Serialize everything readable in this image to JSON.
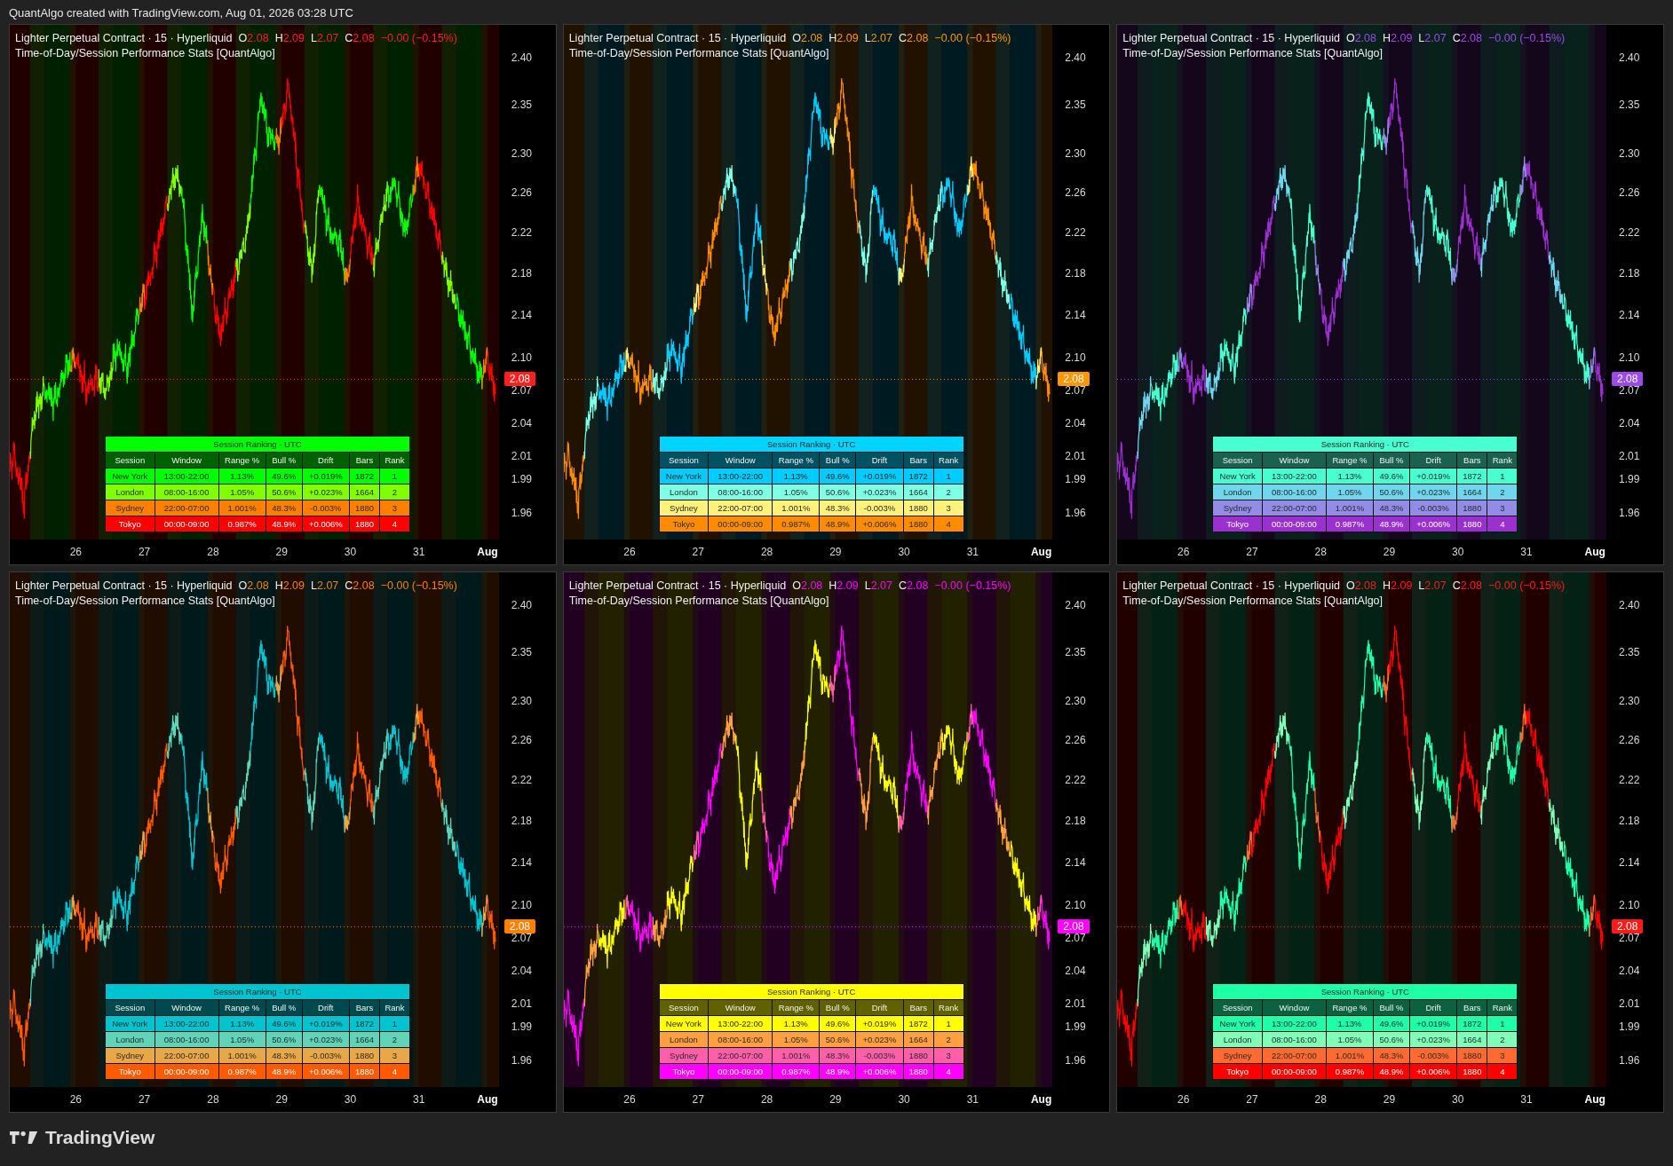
{
  "caption": "QuantAlgo created with TradingView.com, Aug 01, 2026 03:28 UTC",
  "panels": [
    {
      "symbol": "Lighter Perpetual Contract · 15 · Hyperliquid",
      "quote": [
        {
          "label": "O",
          "value": "2.08"
        },
        {
          "label": "H",
          "value": "2.09"
        },
        {
          "label": "L",
          "value": "2.07"
        },
        {
          "label": "C",
          "value": "2.08"
        }
      ],
      "change": "−0.00 (−0.15%)",
      "indicator": "Time-of-Day/Session Performance Stats [QuantAlgo]",
      "color": "#ff1f1f",
      "last_price": "2.08",
      "price_scale": [
        "2.40",
        "2.35",
        "2.30",
        "2.26",
        "2.22",
        "2.18",
        "2.14",
        "2.10",
        "2.07",
        "2.04",
        "2.01",
        "1.99",
        "1.96"
      ],
      "time_scale": [
        {
          "label": "26",
          "kind": "day"
        },
        {
          "label": "27",
          "kind": "day"
        },
        {
          "label": "28",
          "kind": "day"
        },
        {
          "label": "29",
          "kind": "day"
        },
        {
          "label": "30",
          "kind": "day"
        },
        {
          "label": "31",
          "kind": "day"
        },
        {
          "label": "Aug",
          "kind": "month"
        }
      ],
      "table": {
        "title": "Session Ranking · UTC",
        "color": "#00ff00",
        "columns": [
          "Session",
          "Window",
          "Range %",
          "Bull %",
          "Drift",
          "Bars",
          "Rank"
        ],
        "rows": [
          {
            "color": "#00ff00",
            "cells": [
              "New York",
              "13:00-22:00",
              "1.13%",
              "49.6%",
              "+0.019%",
              "1872",
              "1"
            ]
          },
          {
            "color": "#80ff00",
            "cells": [
              "London",
              "08:00-16:00",
              "1.05%",
              "50.6%",
              "+0.023%",
              "1664",
              "2"
            ]
          },
          {
            "color": "#ff8000",
            "cells": [
              "Sydney",
              "22:00-07:00",
              "1.001%",
              "48.3%",
              "-0.003%",
              "1880",
              "3"
            ]
          },
          {
            "color": "#ff0000",
            "cells": [
              "Tokyo",
              "00:00-09:00",
              "0.987%",
              "48.9%",
              "+0.006%",
              "1880",
              "4"
            ]
          }
        ]
      }
    },
    {
      "symbol": "Lighter Perpetual Contract · 15 · Hyperliquid",
      "quote": [
        {
          "label": "O",
          "value": "2.08"
        },
        {
          "label": "H",
          "value": "2.09"
        },
        {
          "label": "L",
          "value": "2.07"
        },
        {
          "label": "C",
          "value": "2.08"
        }
      ],
      "change": "−0.00 (−0.15%)",
      "indicator": "Time-of-Day/Session Performance Stats [QuantAlgo]",
      "color": "#ff9800",
      "last_price": "2.08",
      "price_scale": [
        "2.40",
        "2.35",
        "2.30",
        "2.26",
        "2.22",
        "2.18",
        "2.14",
        "2.10",
        "2.07",
        "2.04",
        "2.01",
        "1.99",
        "1.96"
      ],
      "time_scale": [
        {
          "label": "26",
          "kind": "day"
        },
        {
          "label": "27",
          "kind": "day"
        },
        {
          "label": "28",
          "kind": "day"
        },
        {
          "label": "29",
          "kind": "day"
        },
        {
          "label": "30",
          "kind": "day"
        },
        {
          "label": "31",
          "kind": "day"
        },
        {
          "label": "Aug",
          "kind": "month"
        }
      ],
      "table": {
        "title": "Session Ranking · UTC",
        "color": "#00d4ff",
        "columns": [
          "Session",
          "Window",
          "Range %",
          "Bull %",
          "Drift",
          "Bars",
          "Rank"
        ],
        "rows": [
          {
            "color": "#00ccff",
            "cells": [
              "New York",
              "13:00-22:00",
              "1.13%",
              "49.6%",
              "+0.019%",
              "1872",
              "1"
            ]
          },
          {
            "color": "#7fffe6",
            "cells": [
              "London",
              "08:00-16:00",
              "1.05%",
              "50.6%",
              "+0.023%",
              "1664",
              "2"
            ]
          },
          {
            "color": "#fff27a",
            "cells": [
              "Sydney",
              "22:00-07:00",
              "1.001%",
              "48.3%",
              "-0.003%",
              "1880",
              "3"
            ]
          },
          {
            "color": "#ff8c00",
            "cells": [
              "Tokyo",
              "00:00-09:00",
              "0.987%",
              "48.9%",
              "+0.006%",
              "1880",
              "4"
            ]
          }
        ]
      }
    },
    {
      "symbol": "Lighter Perpetual Contract · 15 · Hyperliquid",
      "quote": [
        {
          "label": "O",
          "value": "2.08"
        },
        {
          "label": "H",
          "value": "2.09"
        },
        {
          "label": "L",
          "value": "2.07"
        },
        {
          "label": "C",
          "value": "2.08"
        }
      ],
      "change": "−0.00 (−0.15%)",
      "indicator": "Time-of-Day/Session Performance Stats [QuantAlgo]",
      "color": "#9c4be8",
      "last_price": "2.08",
      "price_scale": [
        "2.40",
        "2.35",
        "2.30",
        "2.26",
        "2.22",
        "2.18",
        "2.14",
        "2.10",
        "2.07",
        "2.04",
        "2.01",
        "1.99",
        "1.96"
      ],
      "time_scale": [
        {
          "label": "26",
          "kind": "day"
        },
        {
          "label": "27",
          "kind": "day"
        },
        {
          "label": "28",
          "kind": "day"
        },
        {
          "label": "29",
          "kind": "day"
        },
        {
          "label": "30",
          "kind": "day"
        },
        {
          "label": "31",
          "kind": "day"
        },
        {
          "label": "Aug",
          "kind": "month"
        }
      ],
      "table": {
        "title": "Session Ranking · UTC",
        "color": "#47ffd1",
        "columns": [
          "Session",
          "Window",
          "Range %",
          "Bull %",
          "Drift",
          "Bars",
          "Rank"
        ],
        "rows": [
          {
            "color": "#47ffd1",
            "cells": [
              "New York",
              "13:00-22:00",
              "1.13%",
              "49.6%",
              "+0.019%",
              "1872",
              "1"
            ]
          },
          {
            "color": "#6fd6ee",
            "cells": [
              "London",
              "08:00-16:00",
              "1.05%",
              "50.6%",
              "+0.023%",
              "1664",
              "2"
            ]
          },
          {
            "color": "#938ce6",
            "cells": [
              "Sydney",
              "22:00-07:00",
              "1.001%",
              "48.3%",
              "-0.003%",
              "1880",
              "3"
            ]
          },
          {
            "color": "#9b30d0",
            "cells": [
              "Tokyo",
              "00:00-09:00",
              "0.987%",
              "48.9%",
              "+0.006%",
              "1880",
              "4"
            ]
          }
        ]
      }
    },
    {
      "symbol": "Lighter Perpetual Contract · 15 · Hyperliquid",
      "quote": [
        {
          "label": "O",
          "value": "2.08"
        },
        {
          "label": "H",
          "value": "2.09"
        },
        {
          "label": "L",
          "value": "2.07"
        },
        {
          "label": "C",
          "value": "2.08"
        }
      ],
      "change": "−0.00 (−0.15%)",
      "indicator": "Time-of-Day/Session Performance Stats [QuantAlgo]",
      "color": "#ff8000",
      "last_price": "2.08",
      "price_scale": [
        "2.40",
        "2.35",
        "2.30",
        "2.26",
        "2.22",
        "2.18",
        "2.14",
        "2.10",
        "2.07",
        "2.04",
        "2.01",
        "1.99",
        "1.96"
      ],
      "time_scale": [
        {
          "label": "26",
          "kind": "day"
        },
        {
          "label": "27",
          "kind": "day"
        },
        {
          "label": "28",
          "kind": "day"
        },
        {
          "label": "29",
          "kind": "day"
        },
        {
          "label": "30",
          "kind": "day"
        },
        {
          "label": "31",
          "kind": "day"
        },
        {
          "label": "Aug",
          "kind": "month"
        }
      ],
      "table": {
        "title": "Session Ranking · UTC",
        "color": "#00c4d0",
        "columns": [
          "Session",
          "Window",
          "Range %",
          "Bull %",
          "Drift",
          "Bars",
          "Rank"
        ],
        "rows": [
          {
            "color": "#00c4d0",
            "cells": [
              "New York",
              "13:00-22:00",
              "1.13%",
              "49.6%",
              "+0.019%",
              "1872",
              "1"
            ]
          },
          {
            "color": "#5fd4b8",
            "cells": [
              "London",
              "08:00-16:00",
              "1.05%",
              "50.6%",
              "+0.023%",
              "1664",
              "2"
            ]
          },
          {
            "color": "#e8a848",
            "cells": [
              "Sydney",
              "22:00-07:00",
              "1.001%",
              "48.3%",
              "-0.003%",
              "1880",
              "3"
            ]
          },
          {
            "color": "#ff5a00",
            "cells": [
              "Tokyo",
              "00:00-09:00",
              "0.987%",
              "48.9%",
              "+0.006%",
              "1880",
              "4"
            ]
          }
        ]
      }
    },
    {
      "symbol": "Lighter Perpetual Contract · 15 · Hyperliquid",
      "quote": [
        {
          "label": "O",
          "value": "2.08"
        },
        {
          "label": "H",
          "value": "2.09"
        },
        {
          "label": "L",
          "value": "2.07"
        },
        {
          "label": "C",
          "value": "2.08"
        }
      ],
      "change": "−0.00 (−0.15%)",
      "indicator": "Time-of-Day/Session Performance Stats [QuantAlgo]",
      "color": "#ff00ff",
      "last_price": "2.08",
      "price_scale": [
        "2.40",
        "2.35",
        "2.30",
        "2.26",
        "2.22",
        "2.18",
        "2.14",
        "2.10",
        "2.07",
        "2.04",
        "2.01",
        "1.99",
        "1.96"
      ],
      "time_scale": [
        {
          "label": "26",
          "kind": "day"
        },
        {
          "label": "27",
          "kind": "day"
        },
        {
          "label": "28",
          "kind": "day"
        },
        {
          "label": "29",
          "kind": "day"
        },
        {
          "label": "30",
          "kind": "day"
        },
        {
          "label": "31",
          "kind": "day"
        },
        {
          "label": "Aug",
          "kind": "month"
        }
      ],
      "table": {
        "title": "Session Ranking · UTC",
        "color": "#ffff00",
        "columns": [
          "Session",
          "Window",
          "Range %",
          "Bull %",
          "Drift",
          "Bars",
          "Rank"
        ],
        "rows": [
          {
            "color": "#ffff00",
            "cells": [
              "New York",
              "13:00-22:00",
              "1.13%",
              "49.6%",
              "+0.019%",
              "1872",
              "1"
            ]
          },
          {
            "color": "#ffa040",
            "cells": [
              "London",
              "08:00-16:00",
              "1.05%",
              "50.6%",
              "+0.023%",
              "1664",
              "2"
            ]
          },
          {
            "color": "#ff5fa8",
            "cells": [
              "Sydney",
              "22:00-07:00",
              "1.001%",
              "48.3%",
              "-0.003%",
              "1880",
              "3"
            ]
          },
          {
            "color": "#ff00ff",
            "cells": [
              "Tokyo",
              "00:00-09:00",
              "0.987%",
              "48.9%",
              "+0.006%",
              "1880",
              "4"
            ]
          }
        ]
      }
    },
    {
      "symbol": "Lighter Perpetual Contract · 15 · Hyperliquid",
      "quote": [
        {
          "label": "O",
          "value": "2.08"
        },
        {
          "label": "H",
          "value": "2.09"
        },
        {
          "label": "L",
          "value": "2.07"
        },
        {
          "label": "C",
          "value": "2.08"
        }
      ],
      "change": "−0.00 (−0.15%)",
      "indicator": "Time-of-Day/Session Performance Stats [QuantAlgo]",
      "color": "#ff1a1a",
      "last_price": "2.08",
      "price_scale": [
        "2.40",
        "2.35",
        "2.30",
        "2.26",
        "2.22",
        "2.18",
        "2.14",
        "2.10",
        "2.07",
        "2.04",
        "2.01",
        "1.99",
        "1.96"
      ],
      "time_scale": [
        {
          "label": "26",
          "kind": "day"
        },
        {
          "label": "27",
          "kind": "day"
        },
        {
          "label": "28",
          "kind": "day"
        },
        {
          "label": "29",
          "kind": "day"
        },
        {
          "label": "30",
          "kind": "day"
        },
        {
          "label": "31",
          "kind": "day"
        },
        {
          "label": "Aug",
          "kind": "month"
        }
      ],
      "table": {
        "title": "Session Ranking · UTC",
        "color": "#1effa8",
        "columns": [
          "Session",
          "Window",
          "Range %",
          "Bull %",
          "Drift",
          "Bars",
          "Rank"
        ],
        "rows": [
          {
            "color": "#1effa8",
            "cells": [
              "New York",
              "13:00-22:00",
              "1.13%",
              "49.6%",
              "+0.019%",
              "1872",
              "1"
            ]
          },
          {
            "color": "#80ffb8",
            "cells": [
              "London",
              "08:00-16:00",
              "1.05%",
              "50.6%",
              "+0.023%",
              "1664",
              "2"
            ]
          },
          {
            "color": "#ff6a30",
            "cells": [
              "Sydney",
              "22:00-07:00",
              "1.001%",
              "48.3%",
              "-0.003%",
              "1880",
              "3"
            ]
          },
          {
            "color": "#ff0000",
            "cells": [
              "Tokyo",
              "00:00-09:00",
              "0.987%",
              "48.9%",
              "+0.006%",
              "1880",
              "4"
            ]
          }
        ]
      }
    }
  ],
  "logo": "TradingView"
}
